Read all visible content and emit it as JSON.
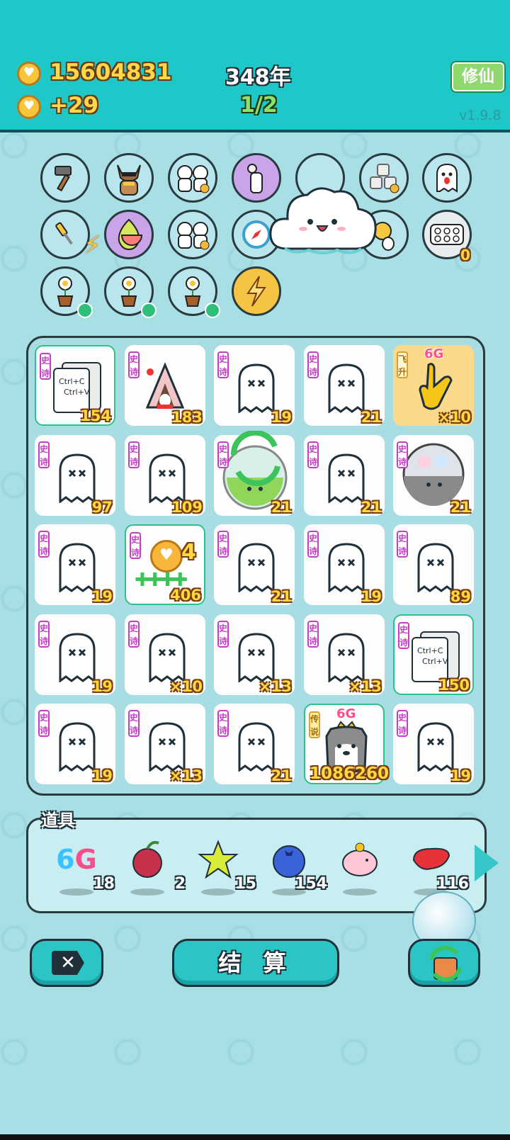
{
  "header": {
    "coins": "15604831",
    "income": "+29",
    "year": "348年",
    "page": "1/2",
    "xiuxian_label": "修仙",
    "version": "v1.9.8"
  },
  "pets": {
    "rows": [
      [
        "hammer-icon",
        "husky-dog-icon",
        "twin-cats-icon",
        "breast-pump-icon",
        "water-glass-icon",
        "sugar-cubes-icon",
        "ghost-tongue-icon"
      ],
      [
        "screwdriver-lightning-icon",
        "pomelo-icon",
        "twin-cats-icon",
        "compass-icon",
        "cloud-icon",
        "chick-egg-icon",
        "egg-tray-icon"
      ],
      [
        "potted-flower-icon",
        "potted-flower-icon",
        "potted-flower-icon",
        "lightning-coin-icon"
      ]
    ],
    "egg_tray_count": "0"
  },
  "board": {
    "cells": [
      {
        "badge": "史诗",
        "count": "154",
        "type": "copy-paste",
        "hl": true
      },
      {
        "badge": "史诗",
        "count": "183",
        "type": "rabbit-tent"
      },
      {
        "badge": "史诗",
        "count": "19",
        "type": "ghost"
      },
      {
        "badge": "史诗",
        "count": "21",
        "type": "ghost"
      },
      {
        "badge": "飞升",
        "count": "×10",
        "type": "hand",
        "tag": "6G",
        "gold": true
      },
      {
        "badge": "史诗",
        "count": "97",
        "type": "ghost"
      },
      {
        "badge": "史诗",
        "count": "109",
        "type": "ghost"
      },
      {
        "badge": "史诗",
        "count": "21",
        "type": "refresh-jar"
      },
      {
        "badge": "史诗",
        "count": "21",
        "type": "ghost"
      },
      {
        "badge": "史诗",
        "count": "21",
        "type": "gacha-ball"
      },
      {
        "badge": "史诗",
        "count": "19",
        "type": "ghost"
      },
      {
        "badge": "史诗",
        "count": "406",
        "type": "coin-clover",
        "hl": true,
        "extra": "4"
      },
      {
        "badge": "史诗",
        "count": "21",
        "type": "ghost"
      },
      {
        "badge": "史诗",
        "count": "19",
        "type": "ghost"
      },
      {
        "badge": "史诗",
        "count": "89",
        "type": "ghost"
      },
      {
        "badge": "史诗",
        "count": "19",
        "type": "ghost"
      },
      {
        "badge": "史诗",
        "count": "×10",
        "type": "ghost"
      },
      {
        "badge": "史诗",
        "count": "×13",
        "type": "ghost"
      },
      {
        "badge": "史诗",
        "count": "×13",
        "type": "ghost"
      },
      {
        "badge": "史诗",
        "count": "150",
        "type": "copy-paste",
        "hl": true
      },
      {
        "badge": "史诗",
        "count": "19",
        "type": "ghost"
      },
      {
        "badge": "史诗",
        "count": "×13",
        "type": "ghost"
      },
      {
        "badge": "史诗",
        "count": "21",
        "type": "ghost"
      },
      {
        "badge": "传说",
        "count": "1086260",
        "type": "king-husky",
        "tag": "6G",
        "hl": true,
        "legend": true
      },
      {
        "badge": "史诗",
        "count": "19",
        "type": "ghost"
      }
    ],
    "copy_label_1": "Ctrl+C",
    "copy_label_2": "Ctrl+V"
  },
  "items": {
    "title": "道具",
    "list": [
      {
        "icon": "6g-icon",
        "text": "6G",
        "qty": "18"
      },
      {
        "icon": "lychee-icon",
        "text": "",
        "qty": "2"
      },
      {
        "icon": "star-icon",
        "text": "",
        "qty": "15"
      },
      {
        "icon": "blueberry-icon",
        "text": "",
        "qty": "154"
      },
      {
        "icon": "piggy-bank-icon",
        "text": "",
        "qty": ""
      },
      {
        "icon": "liver-icon",
        "text": "",
        "qty": "116"
      }
    ]
  },
  "buttons": {
    "settle_label": "结 算"
  },
  "colors": {
    "header_bg": "#1ec7c8",
    "board_bg": "#a8dde3",
    "epic_badge": "#c53fc4",
    "count_text": "#ffd93d"
  }
}
